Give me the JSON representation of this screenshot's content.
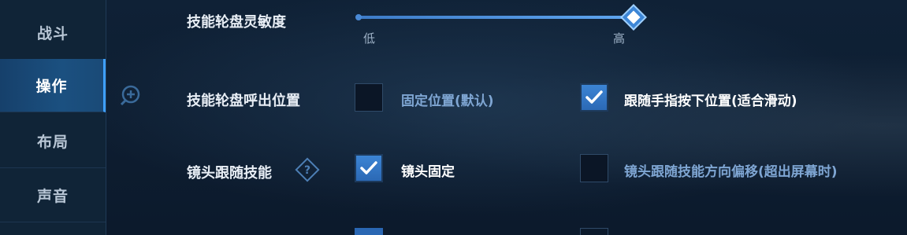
{
  "sidebar": {
    "items": [
      {
        "label": "战斗",
        "active": false
      },
      {
        "label": "操作",
        "active": true
      },
      {
        "label": "布局",
        "active": false
      },
      {
        "label": "声音",
        "active": false
      }
    ]
  },
  "settings": {
    "sensitivity": {
      "label": "技能轮盘灵敏度",
      "min_label": "低",
      "max_label": "高",
      "value_fraction": 1.0
    },
    "wheel_position": {
      "label": "技能轮盘呼出位置",
      "options": [
        {
          "label": "固定位置(默认)",
          "checked": false
        },
        {
          "label": "跟随手指按下位置(适合滑动)",
          "checked": true
        }
      ]
    },
    "camera_follow": {
      "label": "镜头跟随技能",
      "options": [
        {
          "label": "镜头固定",
          "checked": true
        },
        {
          "label": "镜头跟随技能方向偏移(超出屏幕时)",
          "checked": false
        }
      ]
    }
  },
  "icons": {
    "zoom": "zoom-in-icon",
    "help": "question-diamond-icon",
    "check": "checkmark-icon"
  },
  "colors": {
    "accent": "#3d86d6",
    "active_tab": "#1b5080",
    "dim_text": "#7fa6d3"
  }
}
